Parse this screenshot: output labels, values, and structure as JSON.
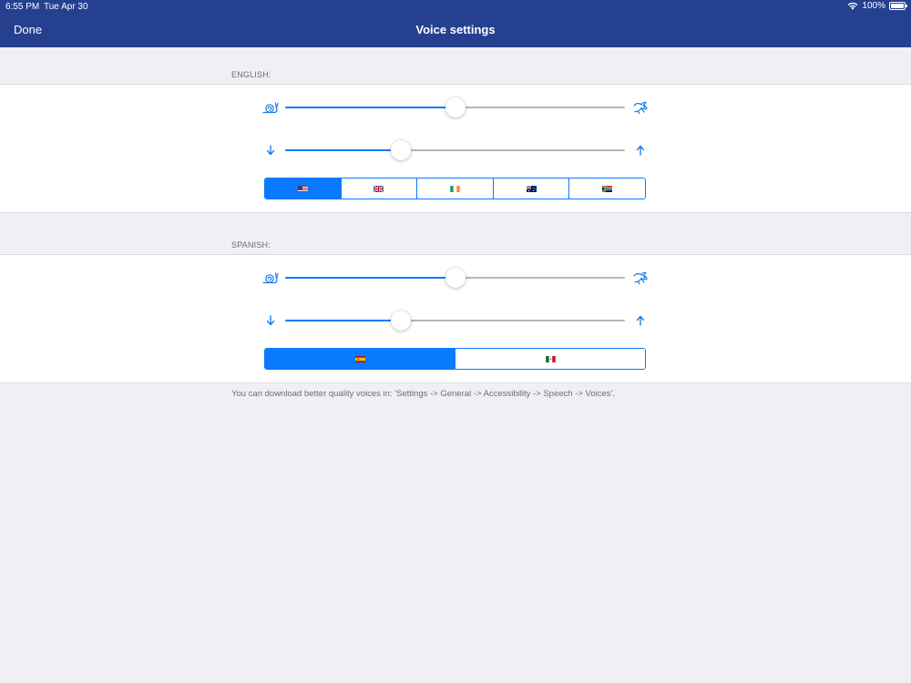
{
  "status_bar": {
    "time": "6:55 PM",
    "date": "Tue Apr 30",
    "battery": "100%",
    "battery_level": 1.0
  },
  "nav": {
    "done_label": "Done",
    "title": "Voice settings"
  },
  "english": {
    "label": "ENGLISH:",
    "speed": {
      "left_icon": "snail-icon",
      "right_icon": "rabbit-icon",
      "value": 0.5
    },
    "pitch": {
      "left_icon": "arrow-down-icon",
      "right_icon": "arrow-up-icon",
      "value": 0.34
    },
    "accents": [
      {
        "id": "us",
        "flag": "US flag",
        "selected": true
      },
      {
        "id": "gb",
        "flag": "UK flag",
        "selected": false
      },
      {
        "id": "ie",
        "flag": "Ireland flag",
        "selected": false
      },
      {
        "id": "au",
        "flag": "Australia flag",
        "selected": false
      },
      {
        "id": "za",
        "flag": "South Africa flag",
        "selected": false
      }
    ]
  },
  "spanish": {
    "label": "SPANISH:",
    "speed": {
      "left_icon": "snail-icon",
      "right_icon": "rabbit-icon",
      "value": 0.5
    },
    "pitch": {
      "left_icon": "arrow-down-icon",
      "right_icon": "arrow-up-icon",
      "value": 0.34
    },
    "accents": [
      {
        "id": "es",
        "flag": "Spain flag",
        "selected": true
      },
      {
        "id": "mx",
        "flag": "Mexico flag",
        "selected": false
      }
    ]
  },
  "footer_note": "You can download better quality voices in: 'Settings -> General -> Accessibility -> Speech -> Voices'.",
  "colors": {
    "nav_bar": "#25408f",
    "accent": "#0a7aff",
    "background": "#efeff4"
  }
}
